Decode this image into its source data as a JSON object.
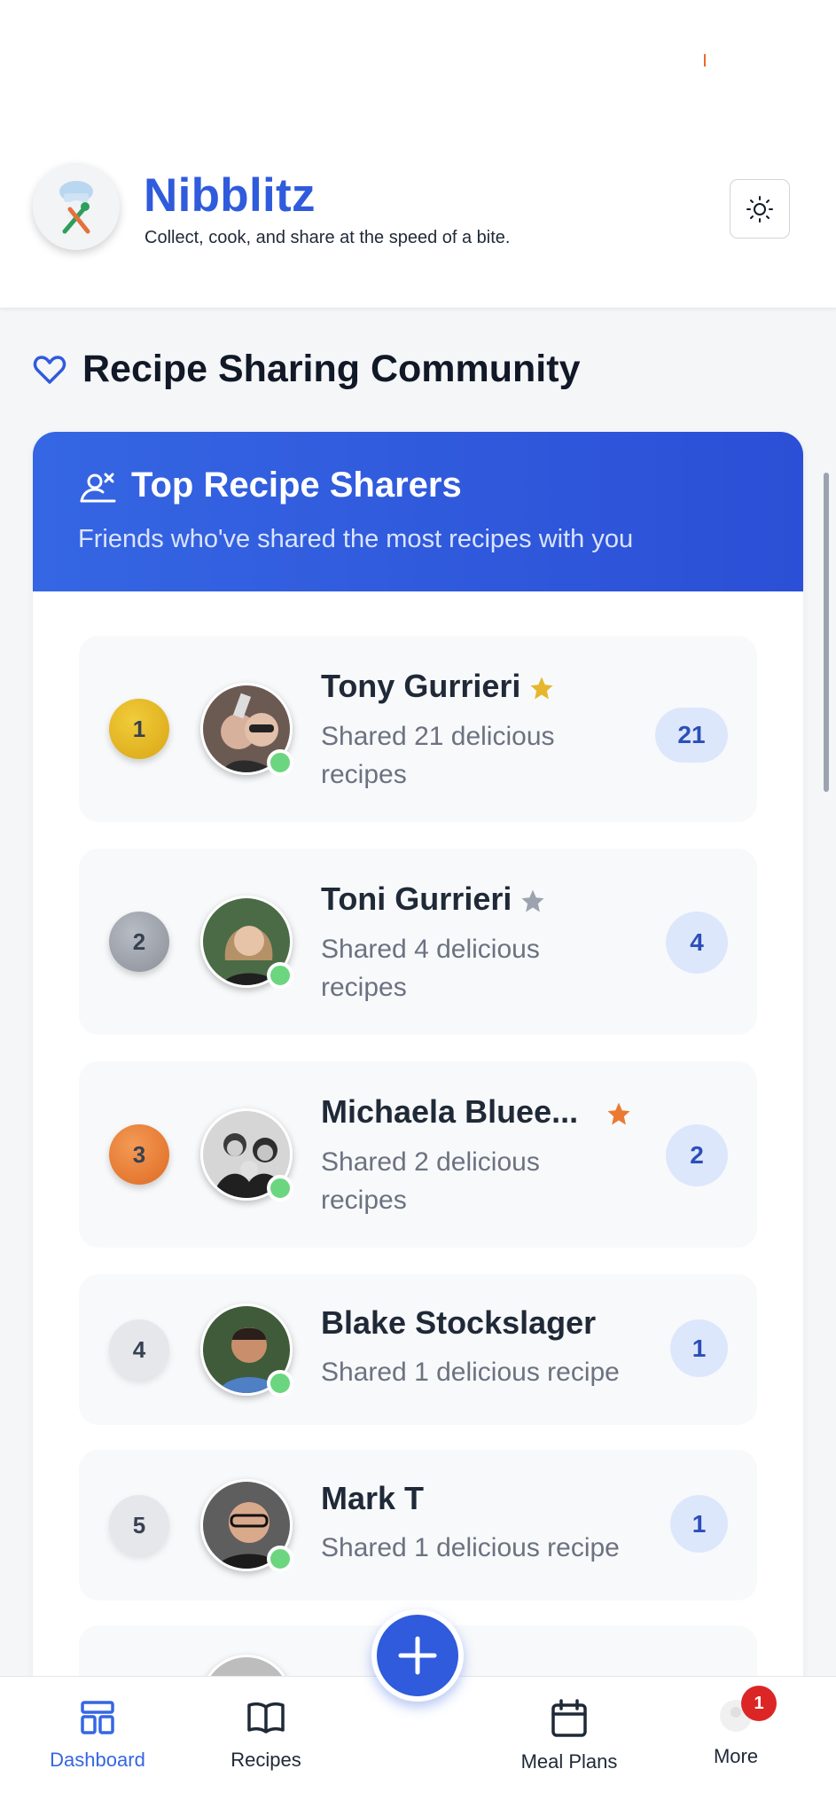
{
  "app": {
    "title": "Nibblitz",
    "tagline": "Collect, cook, and share at the speed of a bite.",
    "logo_icon": "chef-utensils-icon",
    "theme_icon": "sun-icon",
    "accent_color": "#2f5bdc"
  },
  "section": {
    "icon": "heart-outline-icon",
    "title": "Recipe Sharing Community"
  },
  "card": {
    "icon": "user-share-icon",
    "title": "Top Recipe Sharers",
    "subtitle": "Friends who've shared the most recipes with you"
  },
  "sharers": [
    {
      "rank": "1",
      "name": "Tony Gurrieri",
      "desc_line1": "Shared 21 delicious",
      "desc_line2": "recipes",
      "count": "21",
      "star_color": "#e5b82b",
      "rank_color": "#e8b820"
    },
    {
      "rank": "2",
      "name": "Toni Gurrieri",
      "desc_line1": "Shared 4 delicious",
      "desc_line2": "recipes",
      "count": "4",
      "star_color": "#9ca3af",
      "rank_color": "#9ca3af"
    },
    {
      "rank": "3",
      "name": "Michaela Bluee...",
      "desc_line1": "Shared 2 delicious",
      "desc_line2": "recipes",
      "count": "2",
      "star_color": "#ea7a33",
      "rank_color": "#ea7a33"
    },
    {
      "rank": "4",
      "name": "Blake Stockslager",
      "desc_line1": "Shared 1 delicious recipe",
      "count": "1",
      "rank_color": "#e5e7eb"
    },
    {
      "rank": "5",
      "name": "Mark T",
      "desc_line1": "Shared 1 delicious recipe",
      "count": "1",
      "rank_color": "#e5e7eb"
    }
  ],
  "nav": {
    "dashboard": "Dashboard",
    "recipes": "Recipes",
    "meal_plans": "Meal Plans",
    "more": "More",
    "more_badge": "1",
    "fab_icon": "plus-icon"
  }
}
